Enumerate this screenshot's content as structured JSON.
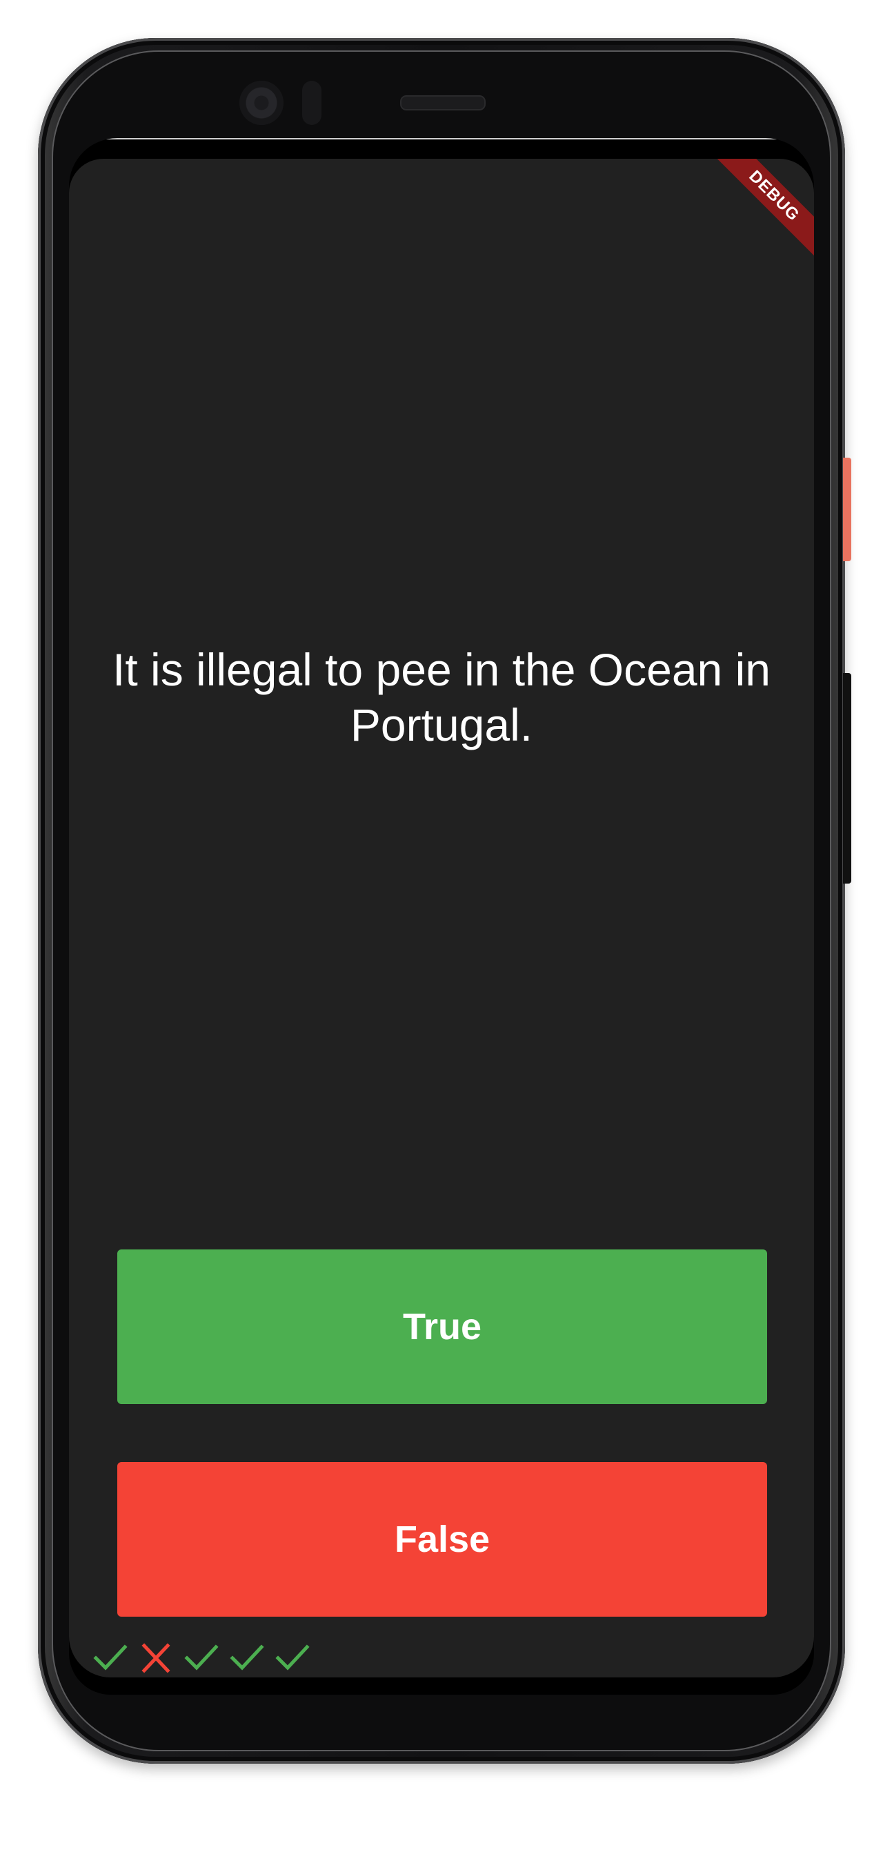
{
  "debug_banner": {
    "label": "DEBUG"
  },
  "quiz": {
    "question": "It is illegal to pee in the Ocean in Portugal.",
    "buttons": {
      "true_label": "True",
      "false_label": "False"
    },
    "score_keeper": [
      {
        "result": "correct",
        "icon": "check-icon",
        "color": "#4caf50"
      },
      {
        "result": "incorrect",
        "icon": "close-icon",
        "color": "#f44336"
      },
      {
        "result": "correct",
        "icon": "check-icon",
        "color": "#4caf50"
      },
      {
        "result": "correct",
        "icon": "check-icon",
        "color": "#4caf50"
      },
      {
        "result": "correct",
        "icon": "check-icon",
        "color": "#4caf50"
      }
    ]
  },
  "colors": {
    "background": "#212121",
    "true_button": "#4caf50",
    "false_button": "#f44336",
    "debug_ribbon": "#8b1a1a"
  }
}
